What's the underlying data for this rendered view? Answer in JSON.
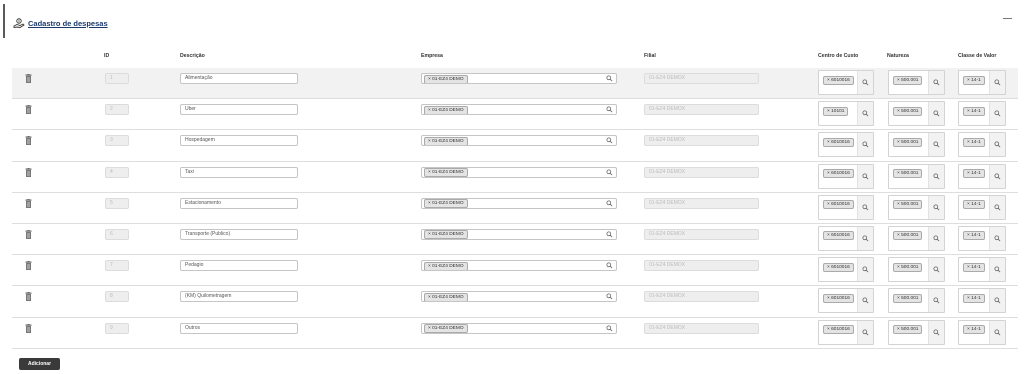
{
  "header": {
    "title": "Cadastro de despesas",
    "collapse_icon": "minus-icon"
  },
  "columns": {
    "id": "ID",
    "descricao": "Descrição",
    "empresa": "Empresa",
    "filial": "Filial",
    "centro_custo": "Centro de Custo",
    "natureza": "Natureza",
    "classe_valor": "Classe de Valor"
  },
  "rows": [
    {
      "id": "1",
      "descricao": "Alimentação",
      "empresa": "× 01-EZ4 DEMO",
      "filial": "01-EZ4 DEMOX",
      "centro_custo": "× 6010016",
      "natureza": "× 500.001",
      "classe_valor": "× 14-1"
    },
    {
      "id": "2",
      "descricao": "Uber",
      "empresa": "× 01-EZ4 DEMO",
      "filial": "01-EZ4 DEMOX",
      "centro_custo": "× 10101",
      "natureza": "× 500.001",
      "classe_valor": "× 14-1"
    },
    {
      "id": "3",
      "descricao": "Hospedagem",
      "empresa": "× 01-EZ4 DEMO",
      "filial": "01-EZ4 DEMOX",
      "centro_custo": "× 6010016",
      "natureza": "× 500.001",
      "classe_valor": "× 14-1"
    },
    {
      "id": "4",
      "descricao": "Taxi",
      "empresa": "× 01-EZ4 DEMO",
      "filial": "01-EZ4 DEMOX",
      "centro_custo": "× 6010016",
      "natureza": "× 500.001",
      "classe_valor": "× 14-1"
    },
    {
      "id": "5",
      "descricao": "Estacionamento",
      "empresa": "× 01-EZ4 DEMO",
      "filial": "01-EZ4 DEMOX",
      "centro_custo": "× 6010016",
      "natureza": "× 500.001",
      "classe_valor": "× 14-1"
    },
    {
      "id": "6",
      "descricao": "Transporte (Publico)",
      "empresa": "× 01-EZ4 DEMO",
      "filial": "01-EZ4 DEMOX",
      "centro_custo": "× 6010016",
      "natureza": "× 500.001",
      "classe_valor": "× 14-1"
    },
    {
      "id": "7",
      "descricao": "Pedagio",
      "empresa": "× 01-EZ4 DEMO",
      "filial": "01-EZ4 DEMOX",
      "centro_custo": "× 6010016",
      "natureza": "× 500.001",
      "classe_valor": "× 14-1"
    },
    {
      "id": "8",
      "descricao": "(KM) Quilometragem",
      "empresa": "× 01-EZ4 DEMO",
      "filial": "01-EZ4 DEMOX",
      "centro_custo": "× 6010016",
      "natureza": "× 500.001",
      "classe_valor": "× 14-1"
    },
    {
      "id": "9",
      "descricao": "Outros",
      "empresa": "× 01-EZ4 DEMO",
      "filial": "01-EZ4 DEMOX",
      "centro_custo": "× 6010016",
      "natureza": "× 500.001",
      "classe_valor": "× 14-1"
    }
  ],
  "actions": {
    "add_label": "Adicionar"
  },
  "icons": {
    "row_delete": "trash-icon",
    "lookup": "search-icon",
    "title": "money-hand-icon"
  }
}
